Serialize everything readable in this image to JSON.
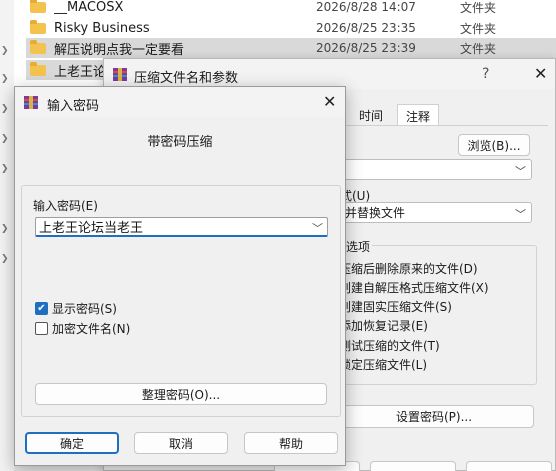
{
  "explorer": {
    "rows": [
      {
        "name": "__MACOSX",
        "date": "2026/8/28 14:07",
        "type": "文件夹",
        "selected": false
      },
      {
        "name": "Risky Business",
        "date": "2026/8/25 23:35",
        "type": "文件夹",
        "selected": false
      },
      {
        "name": "解压说明点我一定要看",
        "date": "2026/8/25 23:39",
        "type": "文件夹",
        "selected": true
      },
      {
        "name": "上老王论坛",
        "date": "",
        "type": "",
        "selected": true
      }
    ]
  },
  "archive_dialog": {
    "title": "压缩文件名和参数",
    "help": "?",
    "close": "✕",
    "tabs": [
      "时间",
      "注释"
    ],
    "browse_label": "浏览(B)...",
    "update_mode_label": "式(U)",
    "update_mode_value": "并替换文件",
    "options_label": "选项",
    "options": [
      "压缩后删除原来的文件(D)",
      "创建自解压格式压缩文件(X)",
      "创建固实压缩文件(S)",
      "添加恢复记录(E)",
      "测试压缩的文件(T)",
      "锁定压缩文件(L)"
    ],
    "set_password_label": "设置密码(P)..."
  },
  "password_dialog": {
    "title": "输入密码",
    "close": "✕",
    "heading": "带密码压缩",
    "field_label": "输入密码(E)",
    "password_value": "上老王论坛当老王",
    "show_password_label": "显示密码(S)",
    "show_password_checked": true,
    "encrypt_names_label": "加密文件名(N)",
    "encrypt_names_checked": false,
    "organize_label": "整理密码(O)...",
    "ok_label": "确定",
    "cancel_label": "取消",
    "help_label": "帮助"
  },
  "icons": {
    "folder": "folder-icon",
    "app": "winrar-icon",
    "dropdown": "chevron-down-icon",
    "check": "check-icon"
  },
  "colors": {
    "accent": "#1f6fbf",
    "folder": "#f4c34f",
    "selection": "#d9d9d9"
  }
}
